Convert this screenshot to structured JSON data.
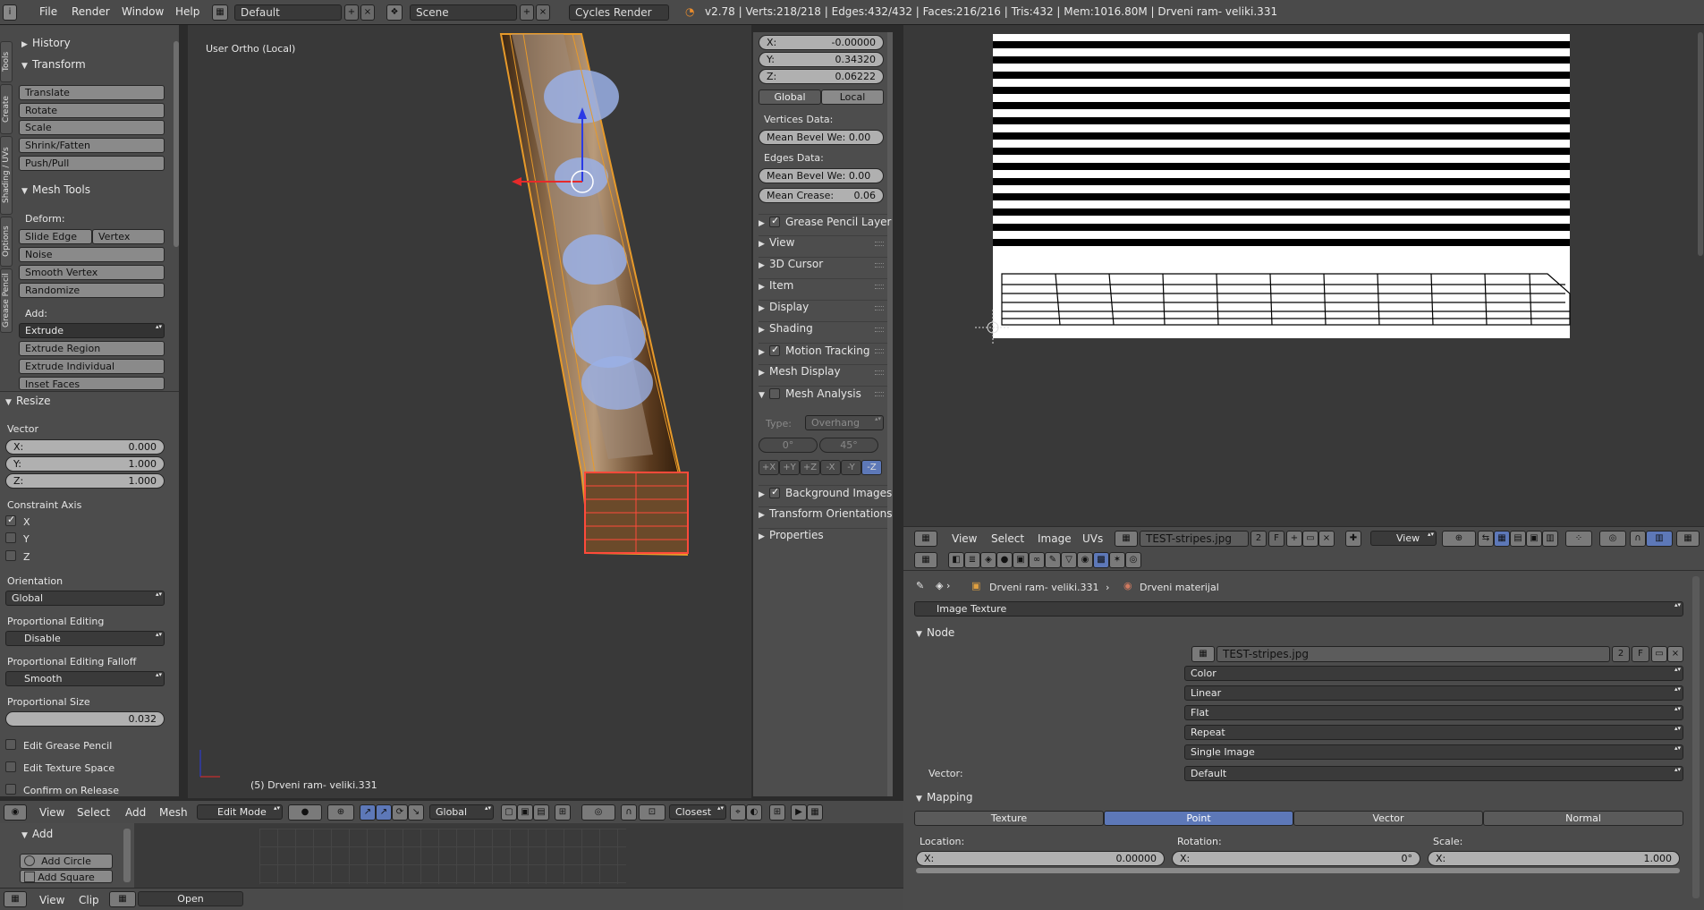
{
  "topbar": {
    "menus": [
      "File",
      "Render",
      "Window",
      "Help"
    ],
    "layout": "Default",
    "scene": "Scene",
    "engine": "Cycles Render",
    "stats": "v2.78 | Verts:218/218 | Edges:432/432 | Faces:216/216 | Tris:432 | Mem:1016.80M | Drveni ram- veliki.331"
  },
  "toolshelf": {
    "tabs": [
      "Tools",
      "Create",
      "Shading / UVs",
      "Options",
      "Grease Pencil"
    ],
    "history": "History",
    "transform": "Transform",
    "transform_buttons": [
      "Translate",
      "Rotate",
      "Scale",
      "Shrink/Fatten",
      "Push/Pull"
    ],
    "mesh_tools": "Mesh Tools",
    "deform": "Deform:",
    "slide_edge": "Slide Edge",
    "vertex": "Vertex",
    "deform_buttons": [
      "Noise",
      "Smooth Vertex",
      "Randomize"
    ],
    "add": "Add:",
    "extrude": "Extrude",
    "add_buttons": [
      "Extrude Region",
      "Extrude Individual",
      "Inset Faces"
    ]
  },
  "resize": {
    "title": "Resize",
    "vector": "Vector",
    "x_label": "X:",
    "x": "0.000",
    "y_label": "Y:",
    "y": "1.000",
    "z_label": "Z:",
    "z": "1.000",
    "constraint": "Constraint Axis",
    "cx": "X",
    "cy": "Y",
    "cz": "Z",
    "orientation_label": "Orientation",
    "orientation": "Global",
    "prop_label": "Proportional Editing",
    "prop": "Disable",
    "falloff_label": "Proportional Editing Falloff",
    "falloff": "Smooth",
    "size_label": "Proportional Size",
    "size": "0.032",
    "grease": "Edit Grease Pencil",
    "texspace": "Edit Texture Space",
    "confirm": "Confirm on Release"
  },
  "viewport": {
    "label": "User Ortho (Local)",
    "object": "(5) Drveni ram- veliki.331"
  },
  "props": {
    "x_label": "X:",
    "x": "-0.00000",
    "y_label": "Y:",
    "y": "0.34320",
    "z_label": "Z:",
    "z": "0.06222",
    "global": "Global",
    "local": "Local",
    "vertices_data": "Vertices Data:",
    "mean_bevel_w": "Mean Bevel We: 0.00",
    "edges_data": "Edges Data:",
    "mean_bevel_w2": "Mean Bevel We: 0.00",
    "mean_crease": "Mean Crease:",
    "crease": "0.06",
    "panels": [
      "Grease Pencil Layer",
      "View",
      "3D Cursor",
      "Item",
      "Display",
      "Shading",
      "Motion Tracking",
      "Mesh Display",
      "Mesh Analysis"
    ],
    "type_label": "Type:",
    "type": "Overhang",
    "angle_min": "0°",
    "angle_max": "45°",
    "axes": [
      "+X",
      "+Y",
      "+Z",
      "-X",
      "-Y",
      "-Z"
    ],
    "panels2": [
      "Background Images",
      "Transform Orientations",
      "Properties"
    ]
  },
  "v3d_header": {
    "menus": [
      "View",
      "Select",
      "Add",
      "Mesh"
    ],
    "mode": "Edit Mode",
    "orientation": "Global",
    "snap": "Closest"
  },
  "image_editor": {
    "menus": [
      "View",
      "Select",
      "Image",
      "UVs"
    ],
    "image": "TEST-stripes.jpg",
    "users": "2",
    "fake": "F",
    "view": "View"
  },
  "node": {
    "breadcrumb_obj": "Drveni ram- veliki.331",
    "breadcrumb_mat": "Drveni materijal",
    "node_type": "Image Texture",
    "node_panel": "Node",
    "image": "TEST-stripes.jpg",
    "users": "2",
    "fake": "F",
    "color": "Color",
    "interp": "Linear",
    "proj": "Flat",
    "ext": "Repeat",
    "source": "Single Image",
    "vector_label": "Vector:",
    "vector": "Default",
    "mapping": "Mapping",
    "map_tabs": [
      "Texture",
      "Point",
      "Vector",
      "Normal"
    ],
    "location": "Location:",
    "rotation": "Rotation:",
    "scale": "Scale:",
    "loc_x_label": "X:",
    "loc_x": "0.00000",
    "rot_x_label": "X:",
    "rot_x": "0°",
    "scl_x_label": "X:",
    "scl_x": "1.000"
  },
  "bottom": {
    "add": "Add",
    "add_circle": "Add Circle",
    "add_square": "Add Square",
    "menus": [
      "View",
      "Clip"
    ],
    "open": "Open"
  }
}
